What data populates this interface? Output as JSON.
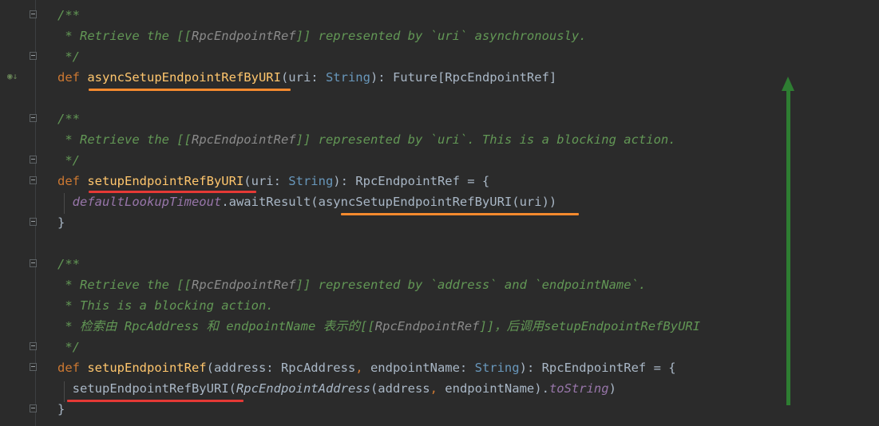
{
  "editor": {
    "language": "scala",
    "lines": [
      {
        "tokens": [
          {
            "cls": "cmt",
            "t": "/**"
          }
        ],
        "fold": "open"
      },
      {
        "tokens": [
          {
            "cls": "cmt",
            "t": " * Retrieve the [["
          },
          {
            "cls": "cmt-ref",
            "t": "RpcEndpointRef"
          },
          {
            "cls": "cmt",
            "t": "]] represented by `uri` asynchronously."
          }
        ]
      },
      {
        "tokens": [
          {
            "cls": "cmt",
            "t": " */"
          }
        ],
        "fold": "end"
      },
      {
        "tokens": [
          {
            "cls": "kw",
            "t": "def "
          },
          {
            "cls": "fn",
            "t": "asyncSetupEndpointRefByURI"
          },
          {
            "cls": "plain",
            "t": "(uri: "
          },
          {
            "cls": "type-str",
            "t": "String"
          },
          {
            "cls": "plain",
            "t": "): Future[RpcEndpointRef]"
          }
        ],
        "marker": "implemented-icon"
      },
      {
        "tokens": []
      },
      {
        "tokens": [
          {
            "cls": "cmt",
            "t": "/**"
          }
        ],
        "fold": "open"
      },
      {
        "tokens": [
          {
            "cls": "cmt",
            "t": " * Retrieve the [["
          },
          {
            "cls": "cmt-ref",
            "t": "RpcEndpointRef"
          },
          {
            "cls": "cmt",
            "t": "]] represented by `uri`. This is a blocking action."
          }
        ]
      },
      {
        "tokens": [
          {
            "cls": "cmt",
            "t": " */"
          }
        ],
        "fold": "end"
      },
      {
        "tokens": [
          {
            "cls": "kw",
            "t": "def "
          },
          {
            "cls": "fn",
            "t": "setupEndpointRefByURI"
          },
          {
            "cls": "plain",
            "t": "(uri: "
          },
          {
            "cls": "type-str",
            "t": "String"
          },
          {
            "cls": "plain",
            "t": "): RpcEndpointRef = {"
          }
        ],
        "fold": "open"
      },
      {
        "tokens": [
          {
            "cls": "plain",
            "t": "  "
          },
          {
            "cls": "field",
            "t": "defaultLookupTimeout"
          },
          {
            "cls": "plain",
            "t": ".awaitResult(asyncSetupEndpointRefByURI(uri))"
          }
        ]
      },
      {
        "tokens": [
          {
            "cls": "plain",
            "t": "}"
          }
        ],
        "fold": "end"
      },
      {
        "tokens": []
      },
      {
        "tokens": [
          {
            "cls": "cmt",
            "t": "/**"
          }
        ],
        "fold": "open"
      },
      {
        "tokens": [
          {
            "cls": "cmt",
            "t": " * Retrieve the [["
          },
          {
            "cls": "cmt-ref",
            "t": "RpcEndpointRef"
          },
          {
            "cls": "cmt",
            "t": "]] represented by `address` and `endpointName`."
          }
        ]
      },
      {
        "tokens": [
          {
            "cls": "cmt",
            "t": " * This is a blocking action."
          }
        ]
      },
      {
        "tokens": [
          {
            "cls": "cmt",
            "t": " * 检索由 RpcAddress 和 endpointName 表示的[["
          },
          {
            "cls": "cmt-ref",
            "t": "RpcEndpointRef"
          },
          {
            "cls": "cmt",
            "t": "]]，后调用setupEndpointRefByURI"
          }
        ]
      },
      {
        "tokens": [
          {
            "cls": "cmt",
            "t": " */"
          }
        ],
        "fold": "end"
      },
      {
        "tokens": [
          {
            "cls": "kw",
            "t": "def "
          },
          {
            "cls": "fn",
            "t": "setupEndpointRef"
          },
          {
            "cls": "plain",
            "t": "(address: RpcAddress"
          },
          {
            "cls": "kw",
            "t": ", "
          },
          {
            "cls": "plain",
            "t": "endpointName: "
          },
          {
            "cls": "type-str",
            "t": "String"
          },
          {
            "cls": "plain",
            "t": "): RpcEndpointRef = {"
          }
        ],
        "fold": "open"
      },
      {
        "tokens": [
          {
            "cls": "plain",
            "t": "  setupEndpointRefByURI("
          },
          {
            "cls": "ital",
            "t": "RpcEndpointAddress"
          },
          {
            "cls": "plain",
            "t": "(address"
          },
          {
            "cls": "kw",
            "t": ", "
          },
          {
            "cls": "plain",
            "t": "endpointName)."
          },
          {
            "cls": "field",
            "t": "toString"
          },
          {
            "cls": "plain",
            "t": ")"
          }
        ]
      },
      {
        "tokens": [
          {
            "cls": "plain",
            "t": "}"
          }
        ],
        "fold": "end"
      }
    ]
  },
  "annotations": {
    "underline_colors": {
      "orange": "#f58a2e",
      "red": "#e53935"
    },
    "arrow_color": "#2e7d32"
  }
}
